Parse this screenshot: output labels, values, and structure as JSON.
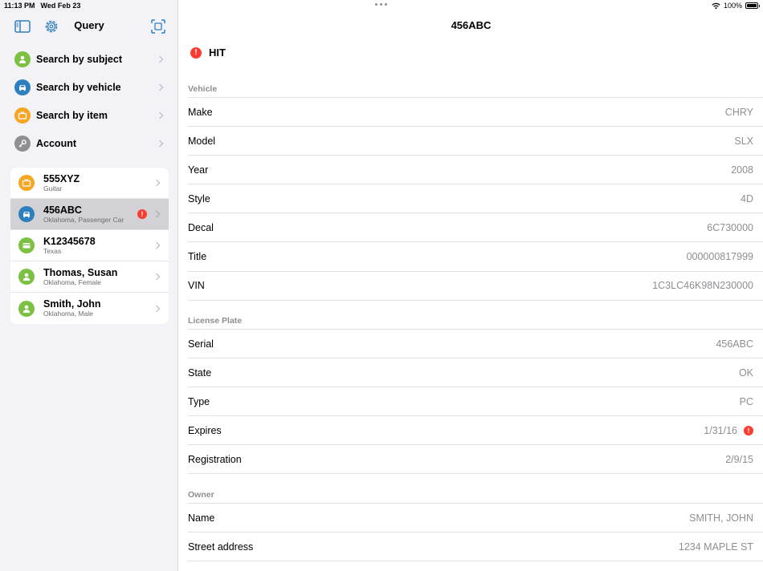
{
  "status": {
    "time": "11:13 PM",
    "date": "Wed Feb 23",
    "battery": "100%"
  },
  "sidebar": {
    "title": "Query",
    "menu": [
      {
        "label": "Search by subject",
        "icon": "person-icon",
        "color": "#7cc142"
      },
      {
        "label": "Search by vehicle",
        "icon": "car-icon",
        "color": "#2f7fbf"
      },
      {
        "label": "Search by item",
        "icon": "tv-icon",
        "color": "#f5a623"
      },
      {
        "label": "Account",
        "icon": "key-icon",
        "color": "#8e8e93"
      }
    ],
    "recent": [
      {
        "title": "555XYZ",
        "subtitle": "Guitar",
        "icon": "tv-icon",
        "color": "#f5a623",
        "alert": false
      },
      {
        "title": "456ABC",
        "subtitle": "Oklahoma, Passenger Car",
        "icon": "car-icon",
        "color": "#2f7fbf",
        "alert": true
      },
      {
        "title": "K12345678",
        "subtitle": "Texas",
        "icon": "card-icon",
        "color": "#7cc142",
        "alert": false
      },
      {
        "title": "Thomas, Susan",
        "subtitle": "Oklahoma, Female",
        "icon": "person-icon",
        "color": "#7cc142",
        "alert": false
      },
      {
        "title": "Smith, John",
        "subtitle": "Oklahoma, Male",
        "icon": "person-icon",
        "color": "#7cc142",
        "alert": false
      }
    ]
  },
  "main": {
    "title": "456ABC",
    "hit_label": "HIT",
    "alert_glyph": "!",
    "sections": [
      {
        "header": "Vehicle",
        "rows": [
          {
            "key": "Make",
            "value": "CHRY"
          },
          {
            "key": "Model",
            "value": "SLX"
          },
          {
            "key": "Year",
            "value": "2008"
          },
          {
            "key": "Style",
            "value": "4D"
          },
          {
            "key": "Decal",
            "value": "6C730000"
          },
          {
            "key": "Title",
            "value": "000000817999"
          },
          {
            "key": "VIN",
            "value": "1C3LC46K98N230000"
          }
        ]
      },
      {
        "header": "License Plate",
        "rows": [
          {
            "key": "Serial",
            "value": "456ABC"
          },
          {
            "key": "State",
            "value": "OK"
          },
          {
            "key": "Type",
            "value": "PC"
          },
          {
            "key": "Expires",
            "value": "1/31/16",
            "alert": true
          },
          {
            "key": "Registration",
            "value": "2/9/15"
          }
        ]
      },
      {
        "header": "Owner",
        "rows": [
          {
            "key": "Name",
            "value": "SMITH, JOHN"
          },
          {
            "key": "Street address",
            "value": "1234 MAPLE ST"
          }
        ]
      }
    ]
  },
  "colors": {
    "accent": "#2f7fbf",
    "alert": "#ff3b30"
  }
}
